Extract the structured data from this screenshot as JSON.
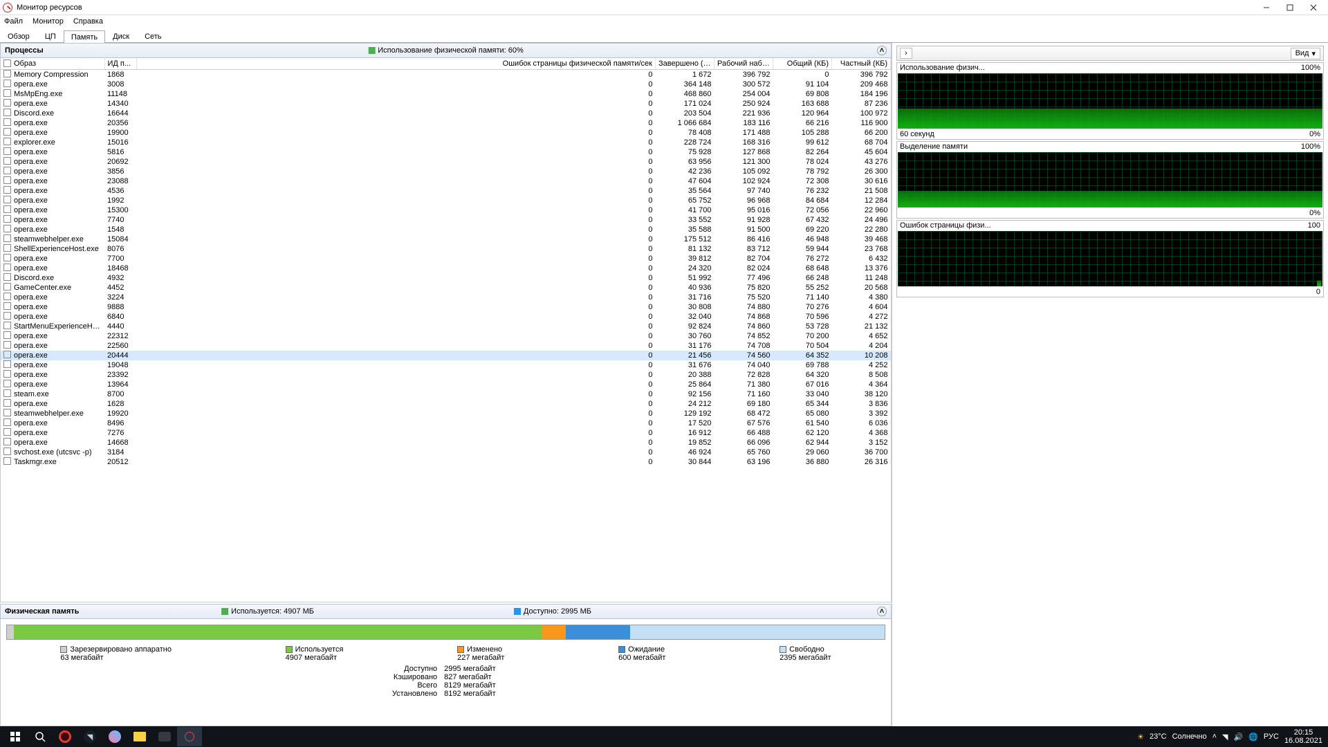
{
  "window": {
    "title": "Монитор ресурсов"
  },
  "menu": {
    "file": "Файл",
    "monitor": "Монитор",
    "help": "Справка"
  },
  "tabs": {
    "overview": "Обзор",
    "cpu": "ЦП",
    "memory": "Память",
    "disk": "Диск",
    "network": "Сеть"
  },
  "processes_header": "Процессы",
  "processes_subtitle": "Использование физической памяти: 60%",
  "columns": {
    "image": "Образ",
    "pid": "ИД п...",
    "hard_faults": "Ошибок страницы физической памяти/сек",
    "commit": "Завершено (КБ)",
    "working_set": "Рабочий набо...",
    "shareable": "Общий (КБ)",
    "private": "Частный (КБ)"
  },
  "processes": [
    {
      "img": "Memory Compression",
      "pid": "1868",
      "hf": "0",
      "cm": "1 672",
      "ws": "396 792",
      "sh": "0",
      "pr": "396 792"
    },
    {
      "img": "opera.exe",
      "pid": "3008",
      "hf": "0",
      "cm": "364 148",
      "ws": "300 572",
      "sh": "91 104",
      "pr": "209 468"
    },
    {
      "img": "MsMpEng.exe",
      "pid": "11148",
      "hf": "0",
      "cm": "468 860",
      "ws": "254 004",
      "sh": "69 808",
      "pr": "184 196"
    },
    {
      "img": "opera.exe",
      "pid": "14340",
      "hf": "0",
      "cm": "171 024",
      "ws": "250 924",
      "sh": "163 688",
      "pr": "87 236"
    },
    {
      "img": "Discord.exe",
      "pid": "16644",
      "hf": "0",
      "cm": "203 504",
      "ws": "221 936",
      "sh": "120 964",
      "pr": "100 972"
    },
    {
      "img": "opera.exe",
      "pid": "20356",
      "hf": "0",
      "cm": "1 066 684",
      "ws": "183 116",
      "sh": "66 216",
      "pr": "116 900"
    },
    {
      "img": "opera.exe",
      "pid": "19900",
      "hf": "0",
      "cm": "78 408",
      "ws": "171 488",
      "sh": "105 288",
      "pr": "66 200"
    },
    {
      "img": "explorer.exe",
      "pid": "15016",
      "hf": "0",
      "cm": "228 724",
      "ws": "168 316",
      "sh": "99 612",
      "pr": "68 704"
    },
    {
      "img": "opera.exe",
      "pid": "5816",
      "hf": "0",
      "cm": "75 928",
      "ws": "127 868",
      "sh": "82 264",
      "pr": "45 604"
    },
    {
      "img": "opera.exe",
      "pid": "20692",
      "hf": "0",
      "cm": "63 956",
      "ws": "121 300",
      "sh": "78 024",
      "pr": "43 276"
    },
    {
      "img": "opera.exe",
      "pid": "3856",
      "hf": "0",
      "cm": "42 236",
      "ws": "105 092",
      "sh": "78 792",
      "pr": "26 300"
    },
    {
      "img": "opera.exe",
      "pid": "23088",
      "hf": "0",
      "cm": "47 604",
      "ws": "102 924",
      "sh": "72 308",
      "pr": "30 616"
    },
    {
      "img": "opera.exe",
      "pid": "4536",
      "hf": "0",
      "cm": "35 564",
      "ws": "97 740",
      "sh": "76 232",
      "pr": "21 508"
    },
    {
      "img": "opera.exe",
      "pid": "1992",
      "hf": "0",
      "cm": "65 752",
      "ws": "96 968",
      "sh": "84 684",
      "pr": "12 284"
    },
    {
      "img": "opera.exe",
      "pid": "15300",
      "hf": "0",
      "cm": "41 700",
      "ws": "95 016",
      "sh": "72 056",
      "pr": "22 960"
    },
    {
      "img": "opera.exe",
      "pid": "7740",
      "hf": "0",
      "cm": "33 552",
      "ws": "91 928",
      "sh": "67 432",
      "pr": "24 496"
    },
    {
      "img": "opera.exe",
      "pid": "1548",
      "hf": "0",
      "cm": "35 588",
      "ws": "91 500",
      "sh": "69 220",
      "pr": "22 280"
    },
    {
      "img": "steamwebhelper.exe",
      "pid": "15084",
      "hf": "0",
      "cm": "175 512",
      "ws": "86 416",
      "sh": "46 948",
      "pr": "39 468"
    },
    {
      "img": "ShellExperienceHost.exe",
      "pid": "8076",
      "hf": "0",
      "cm": "81 132",
      "ws": "83 712",
      "sh": "59 944",
      "pr": "23 768"
    },
    {
      "img": "opera.exe",
      "pid": "7700",
      "hf": "0",
      "cm": "39 812",
      "ws": "82 704",
      "sh": "76 272",
      "pr": "6 432"
    },
    {
      "img": "opera.exe",
      "pid": "18468",
      "hf": "0",
      "cm": "24 320",
      "ws": "82 024",
      "sh": "68 648",
      "pr": "13 376"
    },
    {
      "img": "Discord.exe",
      "pid": "4932",
      "hf": "0",
      "cm": "51 992",
      "ws": "77 496",
      "sh": "66 248",
      "pr": "11 248"
    },
    {
      "img": "GameCenter.exe",
      "pid": "4452",
      "hf": "0",
      "cm": "40 936",
      "ws": "75 820",
      "sh": "55 252",
      "pr": "20 568"
    },
    {
      "img": "opera.exe",
      "pid": "3224",
      "hf": "0",
      "cm": "31 716",
      "ws": "75 520",
      "sh": "71 140",
      "pr": "4 380"
    },
    {
      "img": "opera.exe",
      "pid": "9888",
      "hf": "0",
      "cm": "30 808",
      "ws": "74 880",
      "sh": "70 276",
      "pr": "4 604"
    },
    {
      "img": "opera.exe",
      "pid": "6840",
      "hf": "0",
      "cm": "32 040",
      "ws": "74 868",
      "sh": "70 596",
      "pr": "4 272"
    },
    {
      "img": "StartMenuExperienceHost.exe",
      "pid": "4440",
      "hf": "0",
      "cm": "92 824",
      "ws": "74 860",
      "sh": "53 728",
      "pr": "21 132"
    },
    {
      "img": "opera.exe",
      "pid": "22312",
      "hf": "0",
      "cm": "30 760",
      "ws": "74 852",
      "sh": "70 200",
      "pr": "4 652"
    },
    {
      "img": "opera.exe",
      "pid": "22560",
      "hf": "0",
      "cm": "31 176",
      "ws": "74 708",
      "sh": "70 504",
      "pr": "4 204"
    },
    {
      "img": "opera.exe",
      "pid": "20444",
      "hf": "0",
      "cm": "21 456",
      "ws": "74 560",
      "sh": "64 352",
      "pr": "10 208",
      "sel": true
    },
    {
      "img": "opera.exe",
      "pid": "19048",
      "hf": "0",
      "cm": "31 676",
      "ws": "74 040",
      "sh": "69 788",
      "pr": "4 252"
    },
    {
      "img": "opera.exe",
      "pid": "23392",
      "hf": "0",
      "cm": "20 388",
      "ws": "72 828",
      "sh": "64 320",
      "pr": "8 508"
    },
    {
      "img": "opera.exe",
      "pid": "13964",
      "hf": "0",
      "cm": "25 864",
      "ws": "71 380",
      "sh": "67 016",
      "pr": "4 364"
    },
    {
      "img": "steam.exe",
      "pid": "8700",
      "hf": "0",
      "cm": "92 156",
      "ws": "71 160",
      "sh": "33 040",
      "pr": "38 120"
    },
    {
      "img": "opera.exe",
      "pid": "1628",
      "hf": "0",
      "cm": "24 212",
      "ws": "69 180",
      "sh": "65 344",
      "pr": "3 836"
    },
    {
      "img": "steamwebhelper.exe",
      "pid": "19920",
      "hf": "0",
      "cm": "129 192",
      "ws": "68 472",
      "sh": "65 080",
      "pr": "3 392"
    },
    {
      "img": "opera.exe",
      "pid": "8496",
      "hf": "0",
      "cm": "17 520",
      "ws": "67 576",
      "sh": "61 540",
      "pr": "6 036"
    },
    {
      "img": "opera.exe",
      "pid": "7276",
      "hf": "0",
      "cm": "16 912",
      "ws": "66 488",
      "sh": "62 120",
      "pr": "4 368"
    },
    {
      "img": "opera.exe",
      "pid": "14668",
      "hf": "0",
      "cm": "19 852",
      "ws": "66 096",
      "sh": "62 944",
      "pr": "3 152"
    },
    {
      "img": "svchost.exe (utcsvc -p)",
      "pid": "3184",
      "hf": "0",
      "cm": "46 924",
      "ws": "65 760",
      "sh": "29 060",
      "pr": "36 700"
    },
    {
      "img": "Taskmgr.exe",
      "pid": "20512",
      "hf": "0",
      "cm": "30 844",
      "ws": "63 196",
      "sh": "36 880",
      "pr": "26 316"
    }
  ],
  "phys_header": "Физическая память",
  "phys_used_label": "Используется: 4907 МБ",
  "phys_avail_label": "Доступно: 2995 МБ",
  "mem_legend": {
    "hw": {
      "label": "Зарезервировано аппаратно",
      "val": "63 мегабайт",
      "color": "#cfcfcf"
    },
    "used": {
      "label": "Используется",
      "val": "4907 мегабайт",
      "color": "#7ac943"
    },
    "mod": {
      "label": "Изменено",
      "val": "227 мегабайт",
      "color": "#f7981d"
    },
    "standby": {
      "label": "Ожидание",
      "val": "600 мегабайт",
      "color": "#3b8ed8"
    },
    "free": {
      "label": "Свободно",
      "val": "2395 мегабайт",
      "color": "#c5e0f5"
    }
  },
  "mem_more": {
    "available": {
      "k": "Доступно",
      "v": "2995 мегабайт"
    },
    "cached": {
      "k": "Кэшировано",
      "v": "827 мегабайт"
    },
    "total": {
      "k": "Всего",
      "v": "8129 мегабайт"
    },
    "installed": {
      "k": "Установлено",
      "v": "8192 мегабайт"
    }
  },
  "view_btn": "Вид",
  "graphs": {
    "g1": {
      "title": "Использование физич...",
      "rt": "100%",
      "bl": "60 секунд",
      "br": "0%"
    },
    "g2": {
      "title": "Выделение памяти",
      "rt": "100%",
      "bl": "",
      "br": "0%"
    },
    "g3": {
      "title": "Ошибок страницы физи...",
      "rt": "100",
      "bl": "",
      "br": "0"
    }
  },
  "taskbar": {
    "weather_temp": "23°C",
    "weather_text": "Солнечно",
    "lang": "РУС",
    "time": "20:15",
    "date": "16.08.2021"
  }
}
